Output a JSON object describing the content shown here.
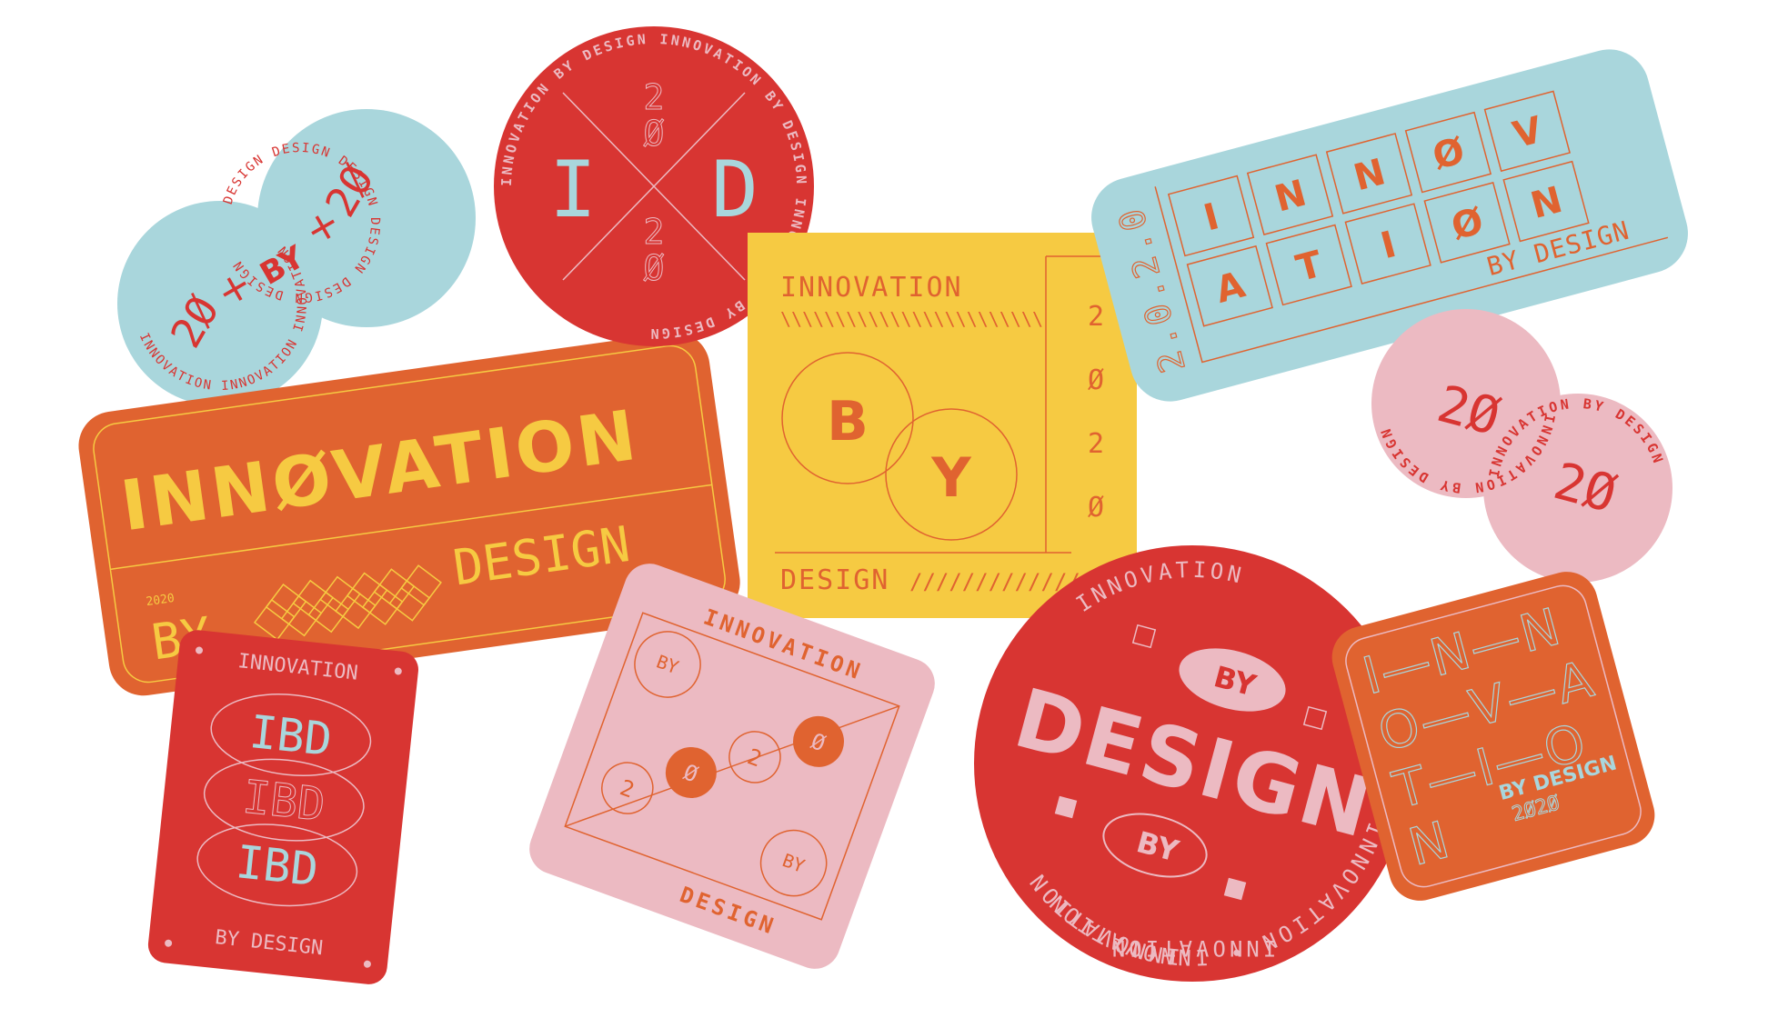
{
  "colors": {
    "red": "#d83532",
    "orange": "#e06330",
    "yellow": "#f6ca42",
    "blue": "#a9d6dc",
    "pink": "#ecbac2",
    "background": "#ffffff"
  },
  "stickers": {
    "blue_twin_circle": {
      "ring_top": "DESIGN DESIGN DESIGN DESIGN DESIGN DESIGN",
      "ring_bottom": "INNOVATION INNOVATION INNOVATION",
      "left_num": "2Ø",
      "right_num": "2Ø",
      "plus": "+",
      "by": "BY"
    },
    "red_id_circle": {
      "ring": "INNOVATION BY DESIGN INNOVATION BY DESIGN INNOVATION BY DESIGN",
      "left_letter": "I",
      "right_letter": "D",
      "top_digit_1": "2",
      "top_digit_2": "Ø",
      "bottom_digit_1": "2",
      "bottom_digit_2": "Ø"
    },
    "orange_banner": {
      "title": "INNØVATION",
      "design": "DESIGN",
      "by": "BY",
      "year": "2020"
    },
    "yellow_square": {
      "top": "INNOVATION",
      "top_hatch": "\\\\\\\\\\\\\\\\\\\\\\\\\\\\\\\\\\\\\\\\\\\\\\\\",
      "b": "B",
      "y": "Y",
      "bottom": "DESIGN",
      "bottom_hatch": "/////////////////",
      "year_digits": [
        "2",
        "Ø",
        "2",
        "Ø"
      ]
    },
    "blue_grid": {
      "year": "2.0.2.0",
      "row1": [
        "I",
        "N",
        "N",
        "Ø",
        "V"
      ],
      "row2": [
        "A",
        "T",
        "I",
        "Ø",
        "N"
      ],
      "by_design": "BY DESIGN"
    },
    "pink_twin_circle": {
      "left_ring": "INNOVATION BY DESIGN",
      "right_ring": "INNOVATION BY DESIGN",
      "left_num": "2Ø",
      "right_num": "2Ø"
    },
    "red_ibd": {
      "top": "INNOVATION",
      "ibd": [
        "IBD",
        "IBD",
        "IBD"
      ],
      "bottom": "BY DESIGN"
    },
    "pink_diamond": {
      "top": "INNOVATION",
      "bottom": "DESIGN",
      "by_1": "BY",
      "by_2": "BY",
      "digits": [
        "2",
        "Ø",
        "2",
        "Ø"
      ]
    },
    "red_big_circle": {
      "ring_top": "INNOVATION • INNOVATION",
      "ring_side_right": "INNOVATION",
      "ring_bottom": "INNOVATION",
      "ring_side_left": "INNOVATION",
      "by_top": "BY",
      "design": "DESIGN",
      "by_bottom": "BY"
    },
    "orange_innovation": {
      "rows": [
        "I—N—N",
        "O—V—A",
        "T—I—O",
        "N"
      ],
      "by_design": "BY DESIGN",
      "year": "2Ø2Ø"
    }
  }
}
